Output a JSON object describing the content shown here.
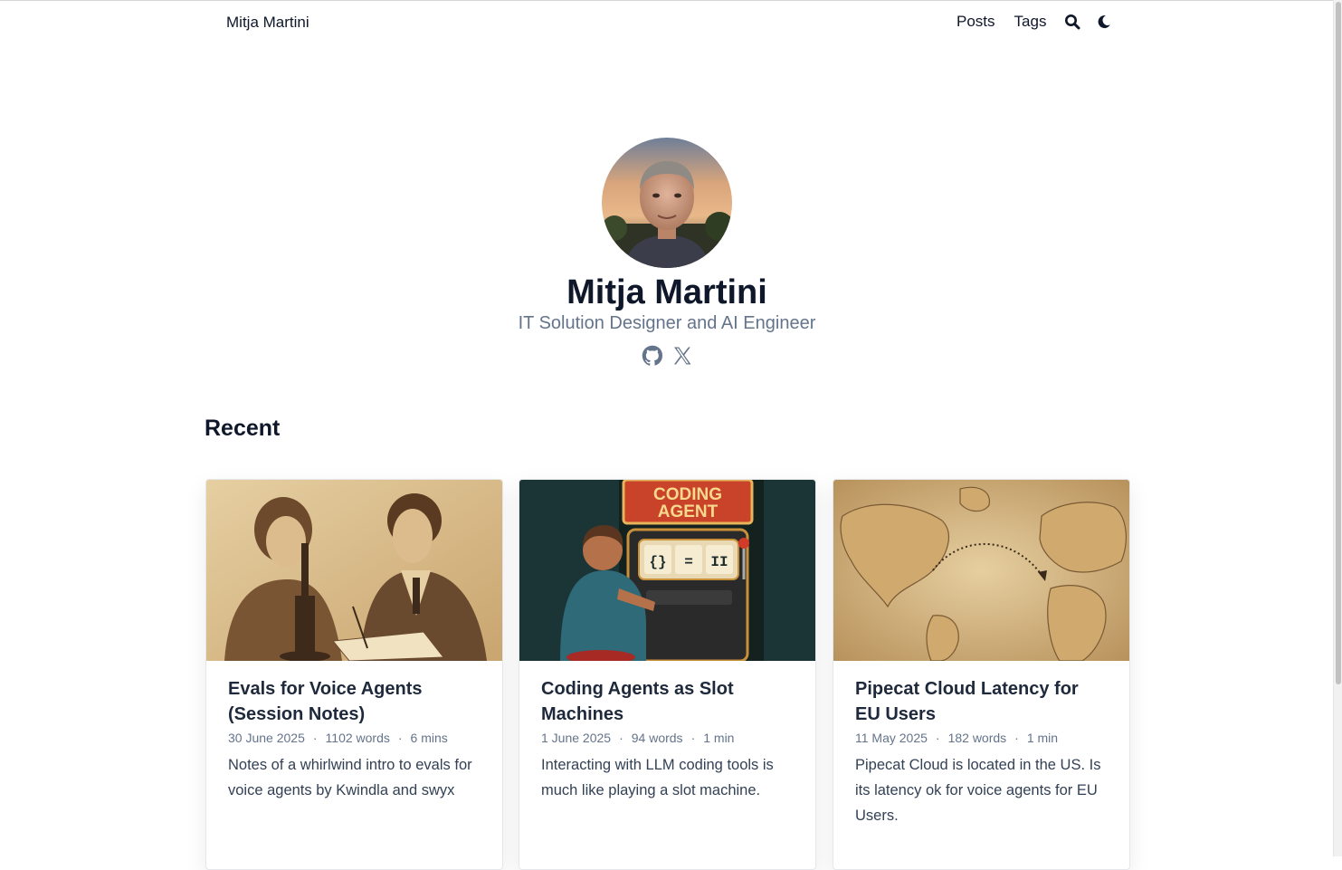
{
  "nav": {
    "brand": "Mitja Martini",
    "links": [
      {
        "label": "Posts"
      },
      {
        "label": "Tags"
      }
    ],
    "icons": [
      "search-icon",
      "moon-icon"
    ]
  },
  "hero": {
    "name": "Mitja Martini",
    "tagline": "IT Solution Designer and AI Engineer",
    "social_icons": [
      "github-icon",
      "x-icon"
    ]
  },
  "recent": {
    "heading": "Recent",
    "posts": [
      {
        "title": "Evals for Voice Agents (Session Notes)",
        "date": "30 June 2025",
        "words": "1102 words",
        "reading_time": "6 mins",
        "summary": "Notes of a whirlwind intro to evals for voice agents by Kwindla and swyx"
      },
      {
        "title": "Coding Agents as Slot Machines",
        "date": "1 June 2025",
        "words": "94 words",
        "reading_time": "1 min",
        "summary": "Interacting with LLM coding tools is much like playing a slot machine.",
        "image_text": [
          "CODING",
          "AGENT"
        ]
      },
      {
        "title": "Pipecat Cloud Latency for EU Users",
        "date": "11 May 2025",
        "words": "182 words",
        "reading_time": "1 min",
        "summary": "Pipecat Cloud is located in the US. Is its latency ok for voice agents for EU Users."
      }
    ]
  },
  "meta_separator": "·",
  "colors": {
    "text": "#0f172a",
    "muted": "#64748b",
    "body": "#334155"
  }
}
